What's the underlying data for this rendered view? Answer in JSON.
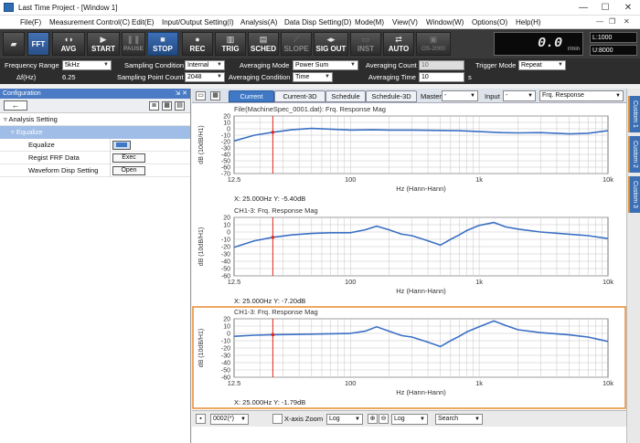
{
  "window": {
    "title": "Last Time Project - [Window 1]",
    "minimize": "—",
    "maximize": "☐",
    "close": "✕",
    "mdi_min": "—",
    "mdi_restore": "❐",
    "mdi_close": "✕"
  },
  "menu": [
    "File(F)",
    "Measurement Control(C)",
    "Edit(E)",
    "Input/Output Setting(I)",
    "Analysis(A)",
    "Data Disp Setting(D)",
    "Mode(M)",
    "View(V)",
    "Window(W)",
    "Options(O)",
    "Help(H)"
  ],
  "toolbar": {
    "fft": "FFT",
    "avg": "AVG",
    "start": "START",
    "pause": "PAUSE",
    "stop": "STOP",
    "rec": "REC",
    "trig": "TRIG",
    "sched": "SCHED",
    "slope": "SLOPE",
    "sigout": "SIG OUT",
    "inst": "INST",
    "auto": "AUTO",
    "os": "OS-2000",
    "rpm_value": "0.0",
    "rpm_unit": "r/min",
    "l_limit": "L:1000",
    "u_limit": "U:8000"
  },
  "conditions": {
    "freq_range_label": "Frequency Range",
    "freq_range": "5kHz",
    "delta_f_label": "Δf(Hz)",
    "delta_f": "6.25",
    "sampling_condition_label": "Sampling Condition",
    "sampling_condition": "Internal",
    "sampling_point_label": "Sampling Point Count",
    "sampling_point": "2048",
    "averaging_mode_label": "Averaging Mode",
    "averaging_mode": "Power Sum",
    "averaging_condition_label": "Averaging Condition",
    "averaging_condition": "Time",
    "averaging_count_label": "Averaging Count",
    "averaging_count": "10",
    "averaging_time_label": "Averaging Time",
    "averaging_time": "10",
    "averaging_time_unit": "s",
    "trigger_mode_label": "Trigger Mode",
    "trigger_mode": "Repeat"
  },
  "config": {
    "title": "Configuration",
    "pin": "⇲ ✕",
    "back": "←",
    "section": "Analysis Setting",
    "subsection": "Equalize",
    "rows": [
      {
        "label": "Equalize",
        "button": ""
      },
      {
        "label": "Regist FRF Data",
        "button": "Exec"
      },
      {
        "label": "Waveform Disp Setting",
        "button": "Open"
      }
    ]
  },
  "graph_tabs": {
    "tabs": [
      "Current",
      "Current-3D",
      "Schedule",
      "Schedule-3D"
    ],
    "master_label": "Master",
    "master": "-",
    "input_label": "Input",
    "input": "-",
    "function": "Frq. Response"
  },
  "right_tabs": [
    "Custom 1",
    "Custom 2",
    "Custom 3"
  ],
  "bottom": {
    "page": "0002(*)",
    "xzoom_label": "X-axis Zoom",
    "xscale": "Log",
    "yscale": "Log",
    "search": "Search"
  },
  "chart_data": [
    {
      "type": "line",
      "title": "File(MachineSpec_0001.dat): Frq. Response Mag",
      "xlabel": "Hz (Hann-Hann)",
      "ylabel": "dB (10dB/H1)",
      "xscale": "log",
      "xlim": [
        12.5,
        10000
      ],
      "ylim": [
        -70,
        20
      ],
      "yticks": [
        20,
        10,
        0,
        -10,
        -20,
        -30,
        -40,
        -50,
        -60,
        -70
      ],
      "xticks": [
        "12.5",
        "100",
        "1k",
        "10k"
      ],
      "cursor_x": 25,
      "readout": "X: 25.000Hz Y: -5.40dB",
      "x": [
        12.5,
        18,
        25,
        35,
        50,
        70,
        100,
        150,
        200,
        300,
        500,
        700,
        1000,
        1500,
        2000,
        3000,
        5000,
        7000,
        10000
      ],
      "y": [
        -19,
        -10,
        -5.4,
        -1.5,
        0.5,
        -0.5,
        -2,
        -1.5,
        -2,
        -2,
        -2.5,
        -3,
        -4.5,
        -6,
        -6.5,
        -6,
        -8,
        -7,
        -3
      ]
    },
    {
      "type": "line",
      "title": "CH1-3: Frq. Response Mag",
      "xlabel": "Hz (Hann-Hann)",
      "ylabel": "dB (10dB/H1)",
      "xscale": "log",
      "xlim": [
        12.5,
        10000
      ],
      "ylim": [
        -60,
        20
      ],
      "yticks": [
        20,
        10,
        0,
        -10,
        -20,
        -30,
        -40,
        -50,
        -60
      ],
      "xticks": [
        "12.5",
        "100",
        "1k",
        "10k"
      ],
      "cursor_x": 25,
      "readout": "X: 25.000Hz Y: -7.20dB",
      "x": [
        12.5,
        18,
        25,
        35,
        50,
        70,
        100,
        130,
        160,
        200,
        250,
        300,
        400,
        500,
        600,
        700,
        800,
        1000,
        1300,
        1600,
        2000,
        3000,
        5000,
        7000,
        10000
      ],
      "y": [
        -21,
        -12,
        -7.2,
        -4,
        -2,
        -1,
        -1,
        3,
        8,
        3,
        -3,
        -5,
        -12,
        -18,
        -10,
        -4,
        2,
        9,
        13,
        7,
        4,
        0,
        -3,
        -5,
        -9
      ]
    },
    {
      "type": "line",
      "title": "CH1-3: Frq. Response Mag",
      "xlabel": "Hz (Hann-Hann)",
      "ylabel": "dB (10dB/H1)",
      "xscale": "log",
      "xlim": [
        12.5,
        10000
      ],
      "ylim": [
        -60,
        20
      ],
      "yticks": [
        20,
        10,
        0,
        -10,
        -20,
        -30,
        -40,
        -50,
        -60
      ],
      "xticks": [
        "12.5",
        "100",
        "1k",
        "10k"
      ],
      "cursor_x": 25,
      "readout": "X: 25.000Hz Y: -1.79dB",
      "x": [
        12.5,
        18,
        25,
        35,
        50,
        70,
        100,
        130,
        160,
        200,
        250,
        300,
        400,
        500,
        600,
        700,
        800,
        1000,
        1300,
        1600,
        2000,
        3000,
        5000,
        7000,
        10000
      ],
      "y": [
        -4,
        -2.5,
        -1.8,
        -1.5,
        -1,
        -0.5,
        0,
        3,
        9,
        3,
        -3,
        -5,
        -12,
        -18,
        -10,
        -4,
        2,
        9,
        17,
        11,
        5,
        1,
        -2,
        -5,
        -11
      ]
    }
  ]
}
